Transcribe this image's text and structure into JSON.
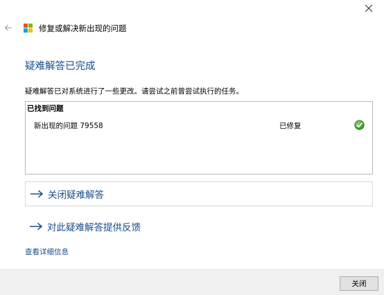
{
  "window": {
    "close_icon": "close-icon"
  },
  "header": {
    "back_icon": "back-arrow-icon",
    "logo_icon": "windows-logo-icon",
    "logo_colors": [
      "#f25022",
      "#7fba00",
      "#00a4ef",
      "#ffb900"
    ],
    "title": "修复或解决新出现的问题"
  },
  "main": {
    "title": "疑难解答已完成",
    "description": "疑难解答已对系统进行了一些更改。请尝试之前曾尝试执行的任务。",
    "accent_color": "#1a4d8c"
  },
  "results": {
    "header": "已找到问题",
    "rows": [
      {
        "name": "新出现的问题 79558",
        "status": "已修复",
        "status_icon": "green-check-icon",
        "status_color": "#3fa535"
      }
    ]
  },
  "actions": {
    "close_troubleshooter": "关闭疑难解答",
    "feedback": "对此疑难解答提供反馈",
    "arrow_icon": "right-arrow-icon"
  },
  "details_link": "查看详细信息",
  "footer": {
    "close_button": "关闭"
  }
}
